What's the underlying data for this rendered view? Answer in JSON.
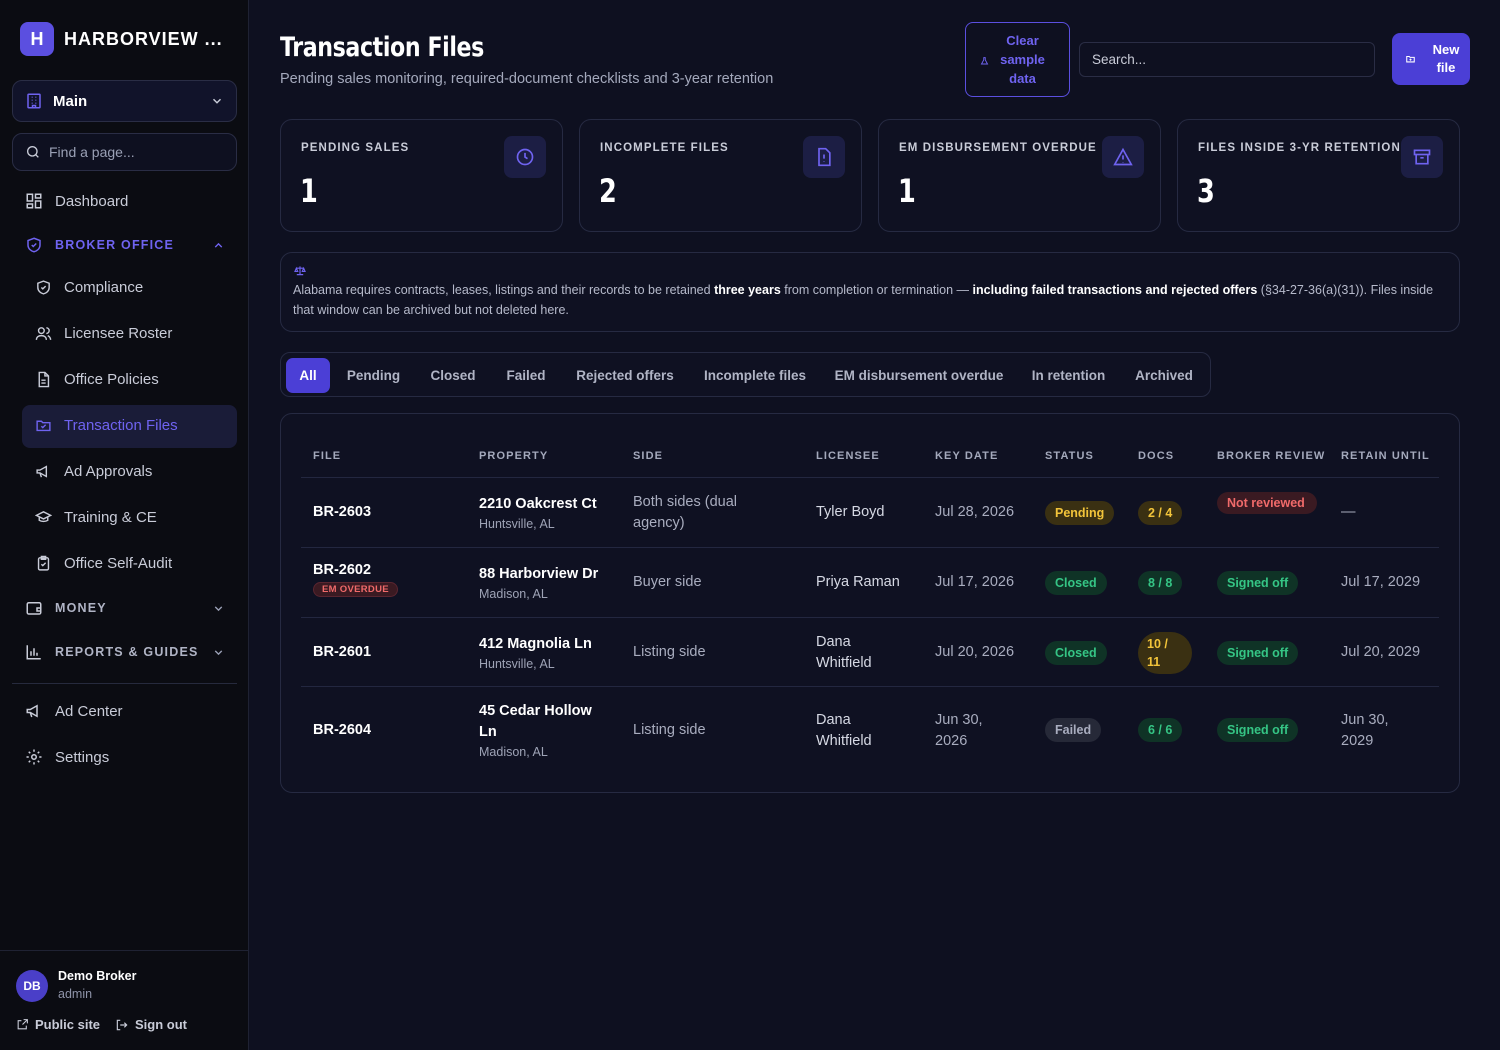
{
  "brand": {
    "initial": "H",
    "name": "HARBORVIEW ..."
  },
  "workspace": {
    "label": "Main"
  },
  "find": {
    "placeholder": "Find a page..."
  },
  "nav": {
    "dashboard": "Dashboard",
    "broker_office": "BROKER OFFICE",
    "compliance": "Compliance",
    "licensee_roster": "Licensee Roster",
    "office_policies": "Office Policies",
    "transaction_files": "Transaction Files",
    "ad_approvals": "Ad Approvals",
    "training": "Training & CE",
    "self_audit": "Office Self-Audit",
    "money": "MONEY",
    "reports": "REPORTS & GUIDES",
    "ad_center": "Ad Center",
    "settings": "Settings"
  },
  "user": {
    "initials": "DB",
    "name": "Demo Broker",
    "role": "admin",
    "public_site": "Public site",
    "sign_out": "Sign out"
  },
  "header": {
    "title": "Transaction Files",
    "subtitle": "Pending sales monitoring, required-document checklists and 3-year retention",
    "clear_label": "Clear sample data",
    "search_placeholder": "Search...",
    "new_label": "New file"
  },
  "stats": [
    {
      "label": "PENDING SALES",
      "value": "1",
      "icon": "clock-icon"
    },
    {
      "label": "INCOMPLETE FILES",
      "value": "2",
      "icon": "file-alert-icon"
    },
    {
      "label": "EM DISBURSEMENT OVERDUE",
      "value": "1",
      "icon": "warning-icon"
    },
    {
      "label": "FILES INSIDE 3-YR RETENTION",
      "value": "3",
      "icon": "archive-icon"
    }
  ],
  "notice": {
    "icon": "scale-icon",
    "text_1": "Alabama requires contracts, leases, listings and their records to be retained ",
    "bold_1": "three years",
    "text_2": " from completion or termination — ",
    "bold_2": "including failed transactions and rejected offers",
    "text_3": " (§34-27-36(a)(31)). Files inside that window can be archived but not deleted here."
  },
  "tabs": [
    "All",
    "Pending",
    "Closed",
    "Failed",
    "Rejected offers",
    "Incomplete files",
    "EM disbursement overdue",
    "In retention",
    "Archived"
  ],
  "table": {
    "headers": [
      "FILE",
      "PROPERTY",
      "SIDE",
      "LICENSEE",
      "KEY DATE",
      "STATUS",
      "DOCS",
      "BROKER REVIEW",
      "RETAIN UNTIL"
    ],
    "rows": [
      {
        "file": "BR-2603",
        "badge": "",
        "street": "2210 Oakcrest Ct",
        "city": "Huntsville, AL",
        "side": "Both sides (dual agency)",
        "licensee": "Tyler Boyd",
        "date": "Jul 28, 2026",
        "status": "Pending",
        "docs": "2 / 4",
        "review": "Not reviewed",
        "retain": "—"
      },
      {
        "file": "BR-2602",
        "badge": "EM OVERDUE",
        "street": "88 Harborview Dr",
        "city": "Madison, AL",
        "side": "Buyer side",
        "licensee": "Priya Raman",
        "date": "Jul 17, 2026",
        "status": "Closed",
        "docs": "8 / 8",
        "review": "Signed off",
        "retain": "Jul 17, 2029"
      },
      {
        "file": "BR-2601",
        "badge": "",
        "street": "412 Magnolia Ln",
        "city": "Huntsville, AL",
        "side": "Listing side",
        "licensee": "Dana Whitfield",
        "date": "Jul 20, 2026",
        "status": "Closed",
        "docs": "10 / 11",
        "review": "Signed off",
        "retain": "Jul 20, 2029"
      },
      {
        "file": "BR-2604",
        "badge": "",
        "street": "45 Cedar Hollow Ln",
        "city": "Madison, AL",
        "side": "Listing side",
        "licensee": "Dana Whitfield",
        "date": "Jun 30, 2026",
        "status": "Failed",
        "docs": "6 / 6",
        "review": "Signed off",
        "retain": "Jun 30, 2029"
      }
    ]
  },
  "colors": {
    "accent": "#4b3fd6",
    "background": "#0e1020",
    "pending": "#f2c43a",
    "closed": "#35c585",
    "alert": "#f06a6a"
  }
}
